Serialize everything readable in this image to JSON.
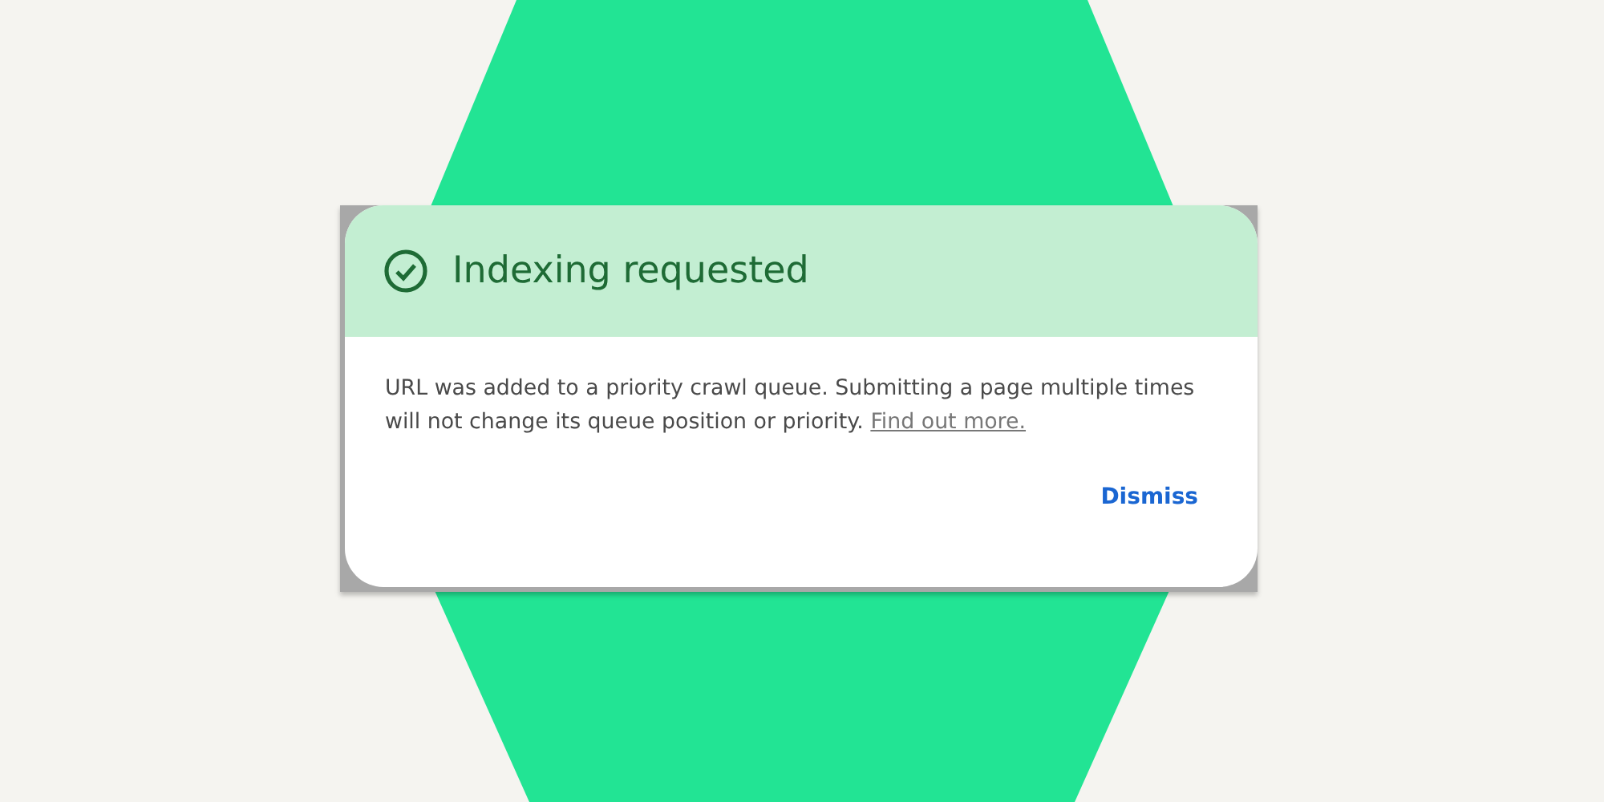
{
  "dialog": {
    "title": "Indexing requested",
    "message": "URL was added to a priority crawl queue. Submitting a page multiple times will not change its queue position or priority.",
    "link": "Find out more.",
    "button": "Dismiss"
  }
}
